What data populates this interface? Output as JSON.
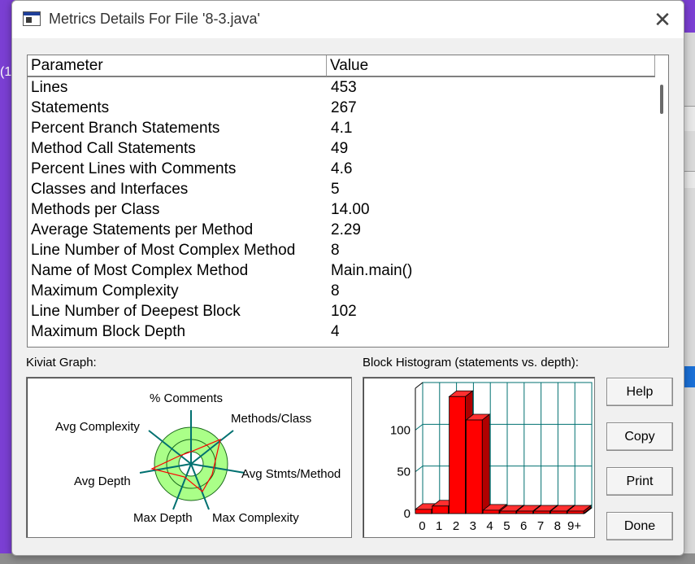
{
  "window": {
    "title": "Metrics Details For File '8-3.java'",
    "close_glyph": "✕"
  },
  "background": {
    "left_fragment": "(1"
  },
  "table": {
    "columns": [
      "Parameter",
      "Value"
    ],
    "rows": [
      {
        "parameter": "Lines",
        "value": "453"
      },
      {
        "parameter": "Statements",
        "value": "267"
      },
      {
        "parameter": "Percent Branch Statements",
        "value": "4.1"
      },
      {
        "parameter": "Method Call Statements",
        "value": "49"
      },
      {
        "parameter": "Percent Lines with Comments",
        "value": "4.6"
      },
      {
        "parameter": "Classes and Interfaces",
        "value": "5"
      },
      {
        "parameter": "Methods per Class",
        "value": "14.00"
      },
      {
        "parameter": "Average Statements per Method",
        "value": "2.29"
      },
      {
        "parameter": "Line Number of Most Complex Method",
        "value": "8"
      },
      {
        "parameter": "Name of Most Complex Method",
        "value": "Main.main()"
      },
      {
        "parameter": "Maximum Complexity",
        "value": "8"
      },
      {
        "parameter": "Line Number of Deepest Block",
        "value": "102"
      },
      {
        "parameter": "Maximum Block Depth",
        "value": "4"
      }
    ]
  },
  "kiviat": {
    "label": "Kiviat Graph:",
    "axes": {
      "comments": "% Comments",
      "methods_class": "Methods/Class",
      "avg_complexity": "Avg Complexity",
      "avg_stmts_method": "Avg Stmts/Method",
      "avg_depth": "Avg Depth",
      "max_depth": "Max Depth",
      "max_complexity": "Max Complexity"
    },
    "colors": {
      "ring": "#aaff88",
      "line": "#ff0000",
      "axis": "#007070"
    }
  },
  "histogram": {
    "label": "Block Histogram (statements vs. depth):",
    "chart_data": {
      "type": "bar",
      "title": "Block Histogram (statements vs. depth):",
      "categories": [
        "0",
        "1",
        "2",
        "3",
        "4",
        "5",
        "6",
        "7",
        "8",
        "9+"
      ],
      "values": [
        5,
        9,
        140,
        112,
        4,
        0,
        0,
        0,
        0,
        0
      ],
      "y_ticks": [
        "0",
        "50",
        "100"
      ],
      "ylim": [
        0,
        150
      ],
      "bar_color": "#ff0000",
      "grid_color": "#007070"
    }
  },
  "buttons": {
    "help": "Help",
    "copy": "Copy",
    "print": "Print",
    "done": "Done"
  }
}
